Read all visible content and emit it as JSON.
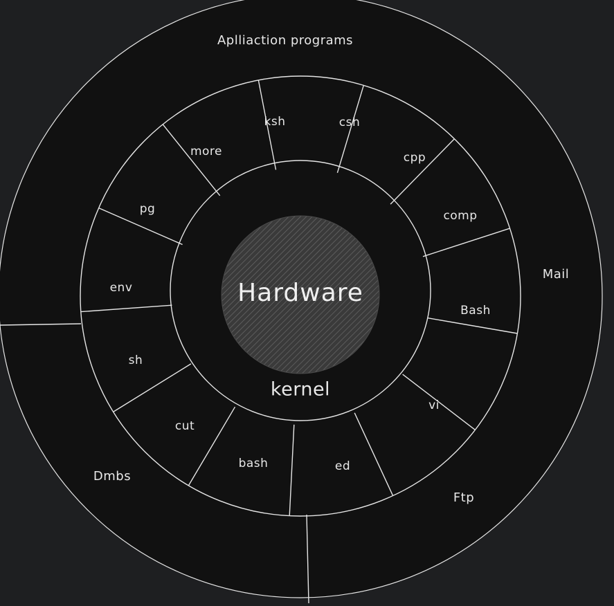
{
  "diagram": {
    "hardware_label": "Hardware",
    "kernel_label": "kernel",
    "shell_commands": [
      {
        "label": "ksh"
      },
      {
        "label": "csh"
      },
      {
        "label": "cpp"
      },
      {
        "label": "comp"
      },
      {
        "label": "Bash"
      },
      {
        "label": "vi"
      },
      {
        "label": "ed"
      },
      {
        "label": "bash"
      },
      {
        "label": "cut"
      },
      {
        "label": "sh"
      },
      {
        "label": "env"
      },
      {
        "label": "pg"
      },
      {
        "label": "more"
      }
    ],
    "application_programs": [
      {
        "label": "Aplliaction programs"
      },
      {
        "label": "Mail"
      },
      {
        "label": "Ftp"
      },
      {
        "label": "Dmbs"
      }
    ]
  },
  "colors": {
    "page_background": "#1e1f21",
    "outer_ring_fill": "#111111",
    "middle_ring_fill": "#121212",
    "kernel_fill": "#151515",
    "hardware_fill": "#3a3a3a",
    "stroke": "#e6e6e6",
    "text": "#e8e8e8"
  }
}
